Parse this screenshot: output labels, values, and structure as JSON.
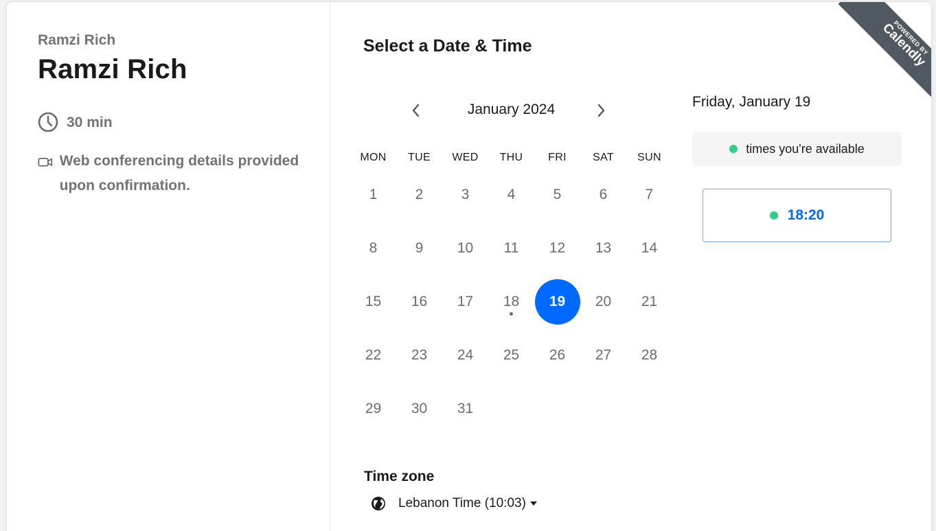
{
  "owner_name": "Ramzi Rich",
  "event_name": "Ramzi Rich",
  "duration": "30 min",
  "conferencing_text": "Web conferencing details provided upon confirmation.",
  "heading": "Select a Date & Time",
  "calendar": {
    "month_label": "January 2024",
    "weekdays": [
      "MON",
      "TUE",
      "WED",
      "THU",
      "FRI",
      "SAT",
      "SUN"
    ],
    "days": [
      "1",
      "2",
      "3",
      "4",
      "5",
      "6",
      "7",
      "8",
      "9",
      "10",
      "11",
      "12",
      "13",
      "14",
      "15",
      "16",
      "17",
      "18",
      "19",
      "20",
      "21",
      "22",
      "23",
      "24",
      "25",
      "26",
      "27",
      "28",
      "29",
      "30",
      "31"
    ],
    "selected_day": "19",
    "today_day": "18"
  },
  "timezone": {
    "label": "Time zone",
    "value": "Lebanon Time (10:03)"
  },
  "selected_date_label": "Friday, January 19",
  "legend_text": "times you're available",
  "time_slots": [
    "18:20"
  ],
  "badge": {
    "small": "POWERED BY",
    "big": "Calendly"
  },
  "colors": {
    "accent": "#0069ff",
    "available": "#2fcf87",
    "badge_bg": "#505962"
  }
}
